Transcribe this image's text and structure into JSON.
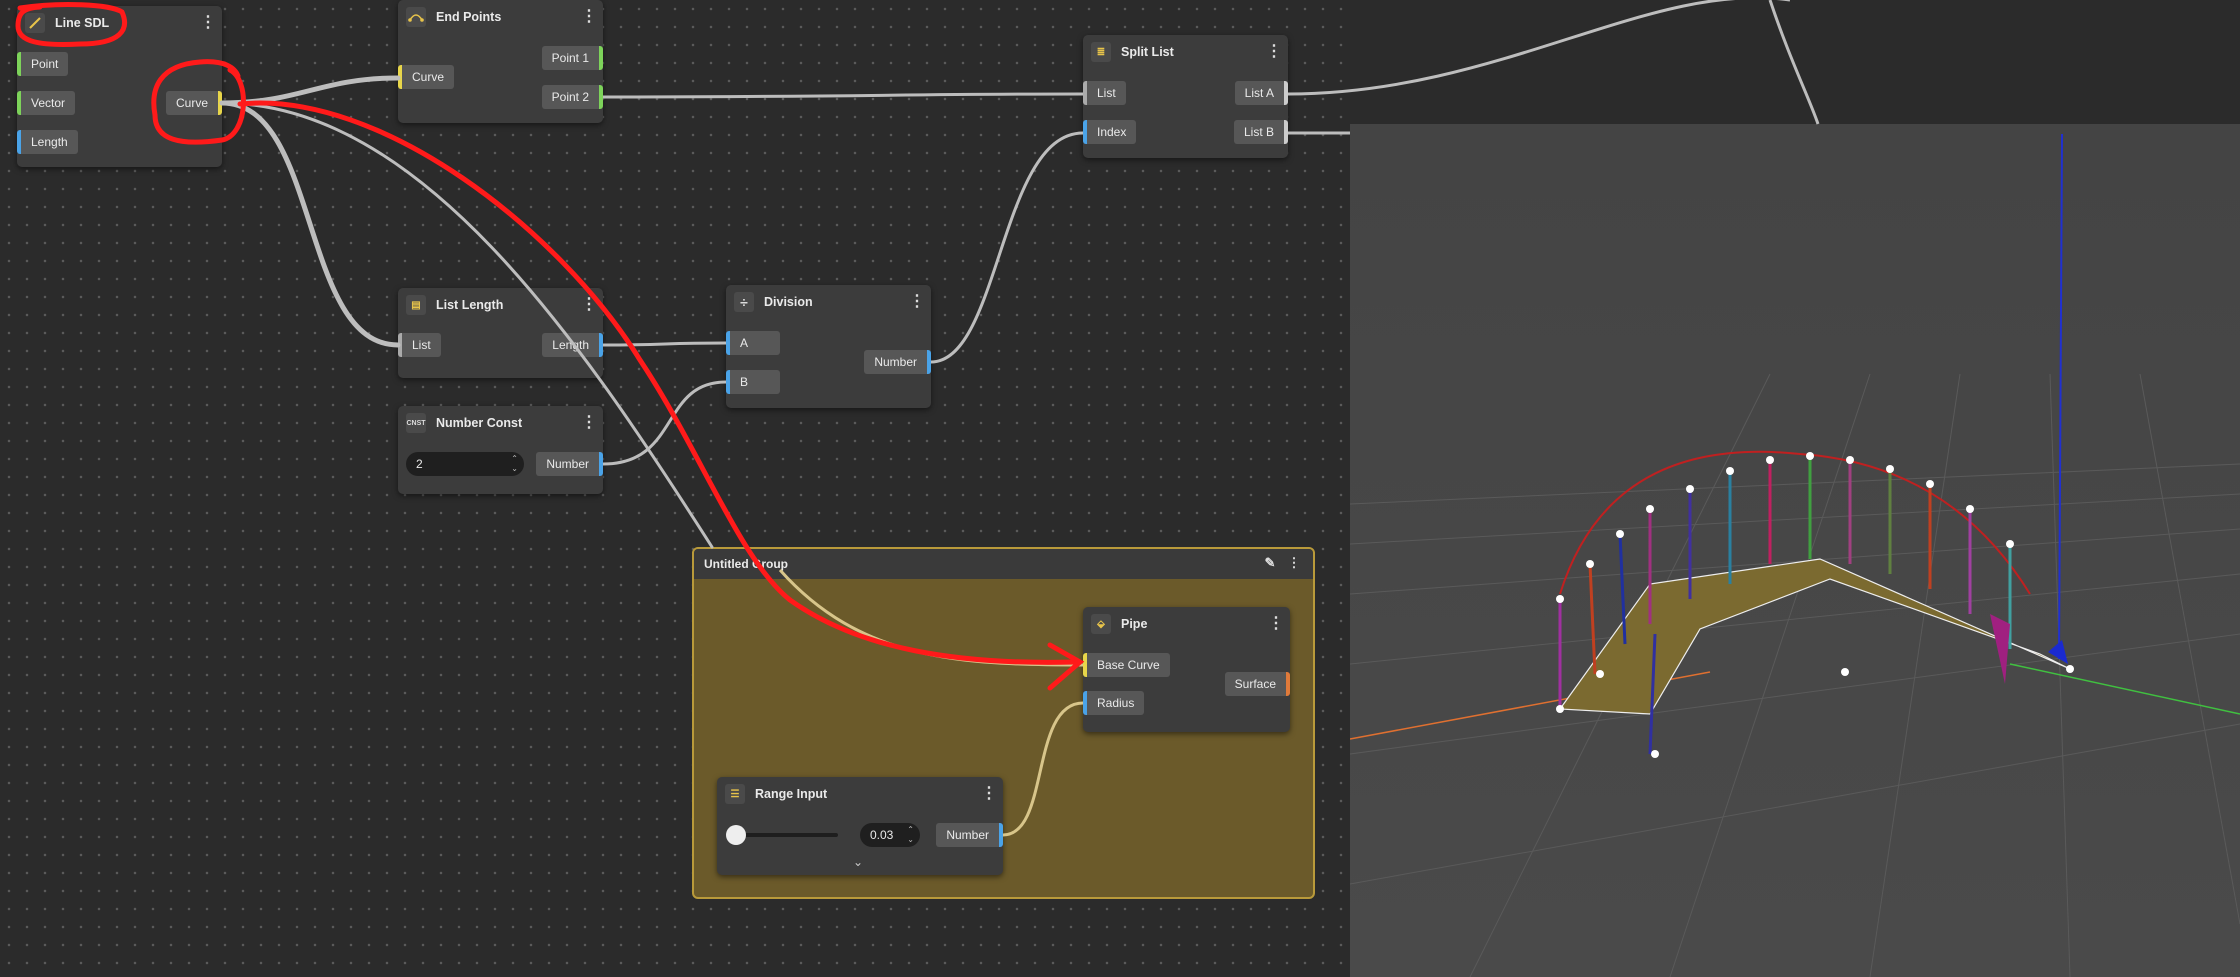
{
  "colors": {
    "canvas": "#2b2b2b",
    "node": "#3c3c3c",
    "port": "#575757",
    "port_green": "#7dd35a",
    "port_blue": "#4aa3e8",
    "port_yellow": "#e8d64a",
    "port_orange": "#e07a3a",
    "group_fill": "#6b5a2a",
    "group_border": "#b99a3a",
    "annotation_red": "#ff1a1a",
    "viewport": "#444444"
  },
  "nodes": {
    "line_sdl": {
      "title": "Line SDL",
      "icon": "line-icon",
      "inputs": [
        "Point",
        "Vector",
        "Length"
      ],
      "output": "Curve"
    },
    "end_points": {
      "title": "End Points",
      "icon": "endpoints-icon",
      "input": "Curve",
      "outputs": [
        "Point 1",
        "Point 2"
      ]
    },
    "split_list": {
      "title": "Split List",
      "icon": "split-list-icon",
      "inputs": [
        "List",
        "Index"
      ],
      "outputs": [
        "List A",
        "List B"
      ]
    },
    "list_length": {
      "title": "List Length",
      "icon": "list-length-icon",
      "input": "List",
      "output": "Length"
    },
    "division": {
      "title": "Division",
      "icon": "division-icon",
      "inputs": [
        "A",
        "B"
      ],
      "output": "Number"
    },
    "number_const": {
      "title": "Number Const",
      "icon": "CNST",
      "value": "2",
      "output": "Number"
    },
    "pipe": {
      "title": "Pipe",
      "icon": "pipe-icon",
      "inputs": [
        "Base Curve",
        "Radius"
      ],
      "output": "Surface"
    },
    "range_input": {
      "title": "Range Input",
      "icon": "sliders-icon",
      "value": "0.03",
      "output": "Number",
      "slider_fraction": 0.0
    }
  },
  "group": {
    "title": "Untitled Group"
  }
}
